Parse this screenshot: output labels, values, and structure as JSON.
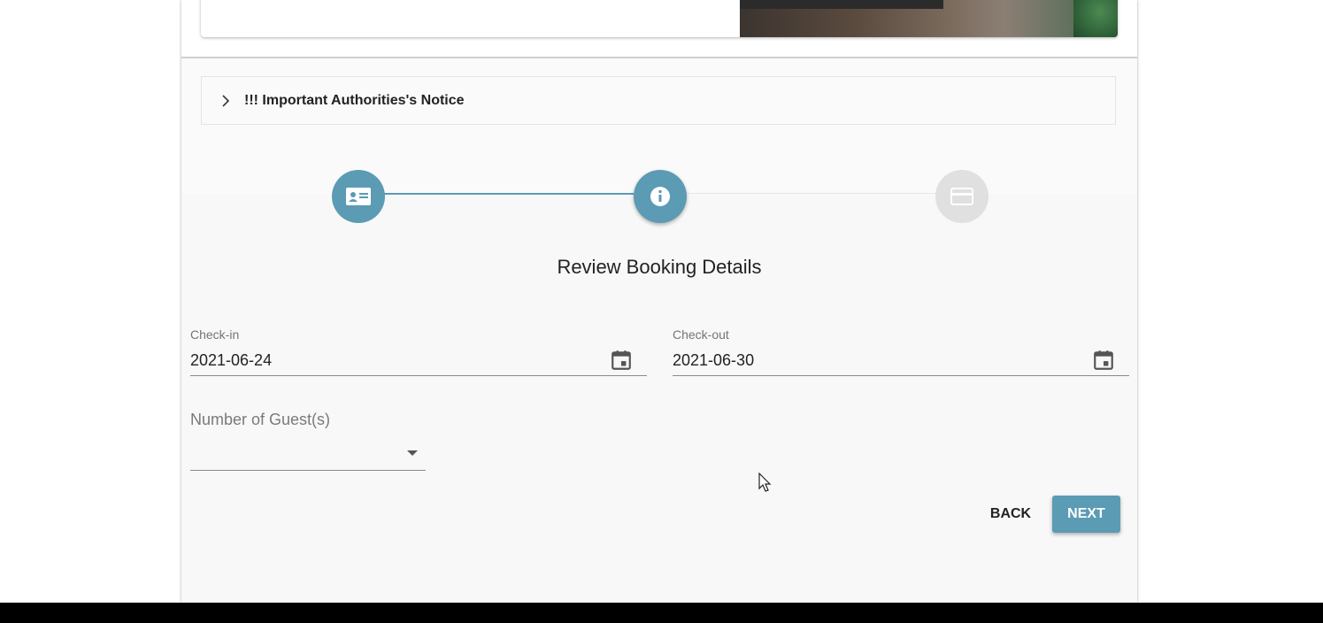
{
  "notice": {
    "title": "!!! Important Authorities's Notice",
    "expand_icon": "chevron-right-icon"
  },
  "stepper": {
    "accent_color": "#5b9bb4",
    "inactive_color": "#e0e0e0",
    "steps": [
      {
        "icon": "contact-card-icon",
        "state": "completed"
      },
      {
        "icon": "info-icon",
        "state": "current"
      },
      {
        "icon": "payment-card-icon",
        "state": "upcoming"
      }
    ]
  },
  "section": {
    "title": "Review Booking Details"
  },
  "checkin": {
    "label": "Check-in",
    "value": "2021-06-24",
    "icon": "calendar-icon"
  },
  "checkout": {
    "label": "Check-out",
    "value": "2021-06-30",
    "icon": "calendar-icon"
  },
  "guests": {
    "label": "Number of Guest(s)",
    "value": "",
    "icon": "dropdown-caret-icon"
  },
  "actions": {
    "back_label": "BACK",
    "next_label": "NEXT"
  }
}
